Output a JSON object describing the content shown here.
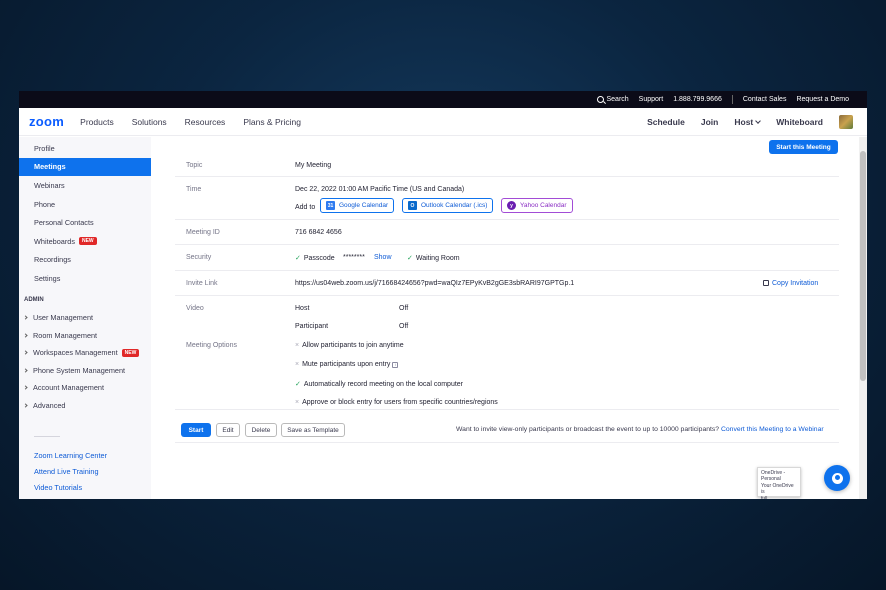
{
  "topbar": {
    "search": "Search",
    "support": "Support",
    "phone": "1.888.799.9666",
    "contact_sales": "Contact Sales",
    "request_demo": "Request a Demo"
  },
  "navbar": {
    "logo": "zoom",
    "left": [
      "Products",
      "Solutions",
      "Resources",
      "Plans & Pricing"
    ],
    "schedule": "Schedule",
    "join": "Join",
    "host": "Host",
    "whiteboard": "Whiteboard"
  },
  "sidebar": {
    "items": [
      {
        "label": "Profile"
      },
      {
        "label": "Meetings",
        "active": true
      },
      {
        "label": "Webinars"
      },
      {
        "label": "Phone"
      },
      {
        "label": "Personal Contacts"
      },
      {
        "label": "Whiteboards",
        "badge": "NEW"
      },
      {
        "label": "Recordings"
      },
      {
        "label": "Settings"
      }
    ],
    "admin_label": "ADMIN",
    "admin_groups": [
      {
        "label": "User Management"
      },
      {
        "label": "Room Management"
      },
      {
        "label": "Workspaces Management",
        "badge": "NEW"
      },
      {
        "label": "Phone System Management"
      },
      {
        "label": "Account Management"
      },
      {
        "label": "Advanced"
      }
    ],
    "links": [
      "Zoom Learning Center",
      "Attend Live Training",
      "Video Tutorials"
    ]
  },
  "meeting": {
    "start_this_meeting": "Start this Meeting",
    "topic_label": "Topic",
    "topic": "My Meeting",
    "time_label": "Time",
    "time": "Dec 22, 2022 01:00 AM Pacific Time (US and Canada)",
    "add_to": "Add to",
    "google_calendar": "Google Calendar",
    "outlook_calendar": "Outlook Calendar (.ics)",
    "yahoo_calendar": "Yahoo Calendar",
    "meeting_id_label": "Meeting ID",
    "meeting_id": "716 6842 4656",
    "security_label": "Security",
    "passcode_label": "Passcode",
    "passcode_mask": "********",
    "show": "Show",
    "waiting_room": "Waiting Room",
    "invite_link_label": "Invite Link",
    "invite_link": "https://us04web.zoom.us/j/71668424656?pwd=waQIz7EPyKvB2gGE3sbRARI97GPTGp.1",
    "copy_invitation": "Copy Invitation",
    "video_label": "Video",
    "host_label": "Host",
    "host_value": "Off",
    "participant_label": "Participant",
    "participant_value": "Off",
    "options_label": "Meeting Options",
    "options": [
      {
        "label": "Allow participants to join anytime",
        "enabled": false
      },
      {
        "label": "Mute participants upon entry",
        "enabled": false
      },
      {
        "label": "Automatically record meeting on the local computer",
        "enabled": true
      },
      {
        "label": "Approve or block entry for users from specific countries/regions",
        "enabled": false
      }
    ],
    "start": "Start",
    "edit": "Edit",
    "delete": "Delete",
    "save_template": "Save as Template",
    "webinar_prompt": "Want to invite view-only participants or broadcast the event to up to 10000 participants?",
    "convert_webinar": "Convert this Meeting to a Webinar"
  },
  "toast": {
    "line1": "OneDrive -",
    "line2": "Personal",
    "line3": "Your OneDrive is",
    "line4": "full"
  },
  "colors": {
    "brand": "#0b5cff",
    "accent": "#0e72ed",
    "check": "#23a35a"
  }
}
